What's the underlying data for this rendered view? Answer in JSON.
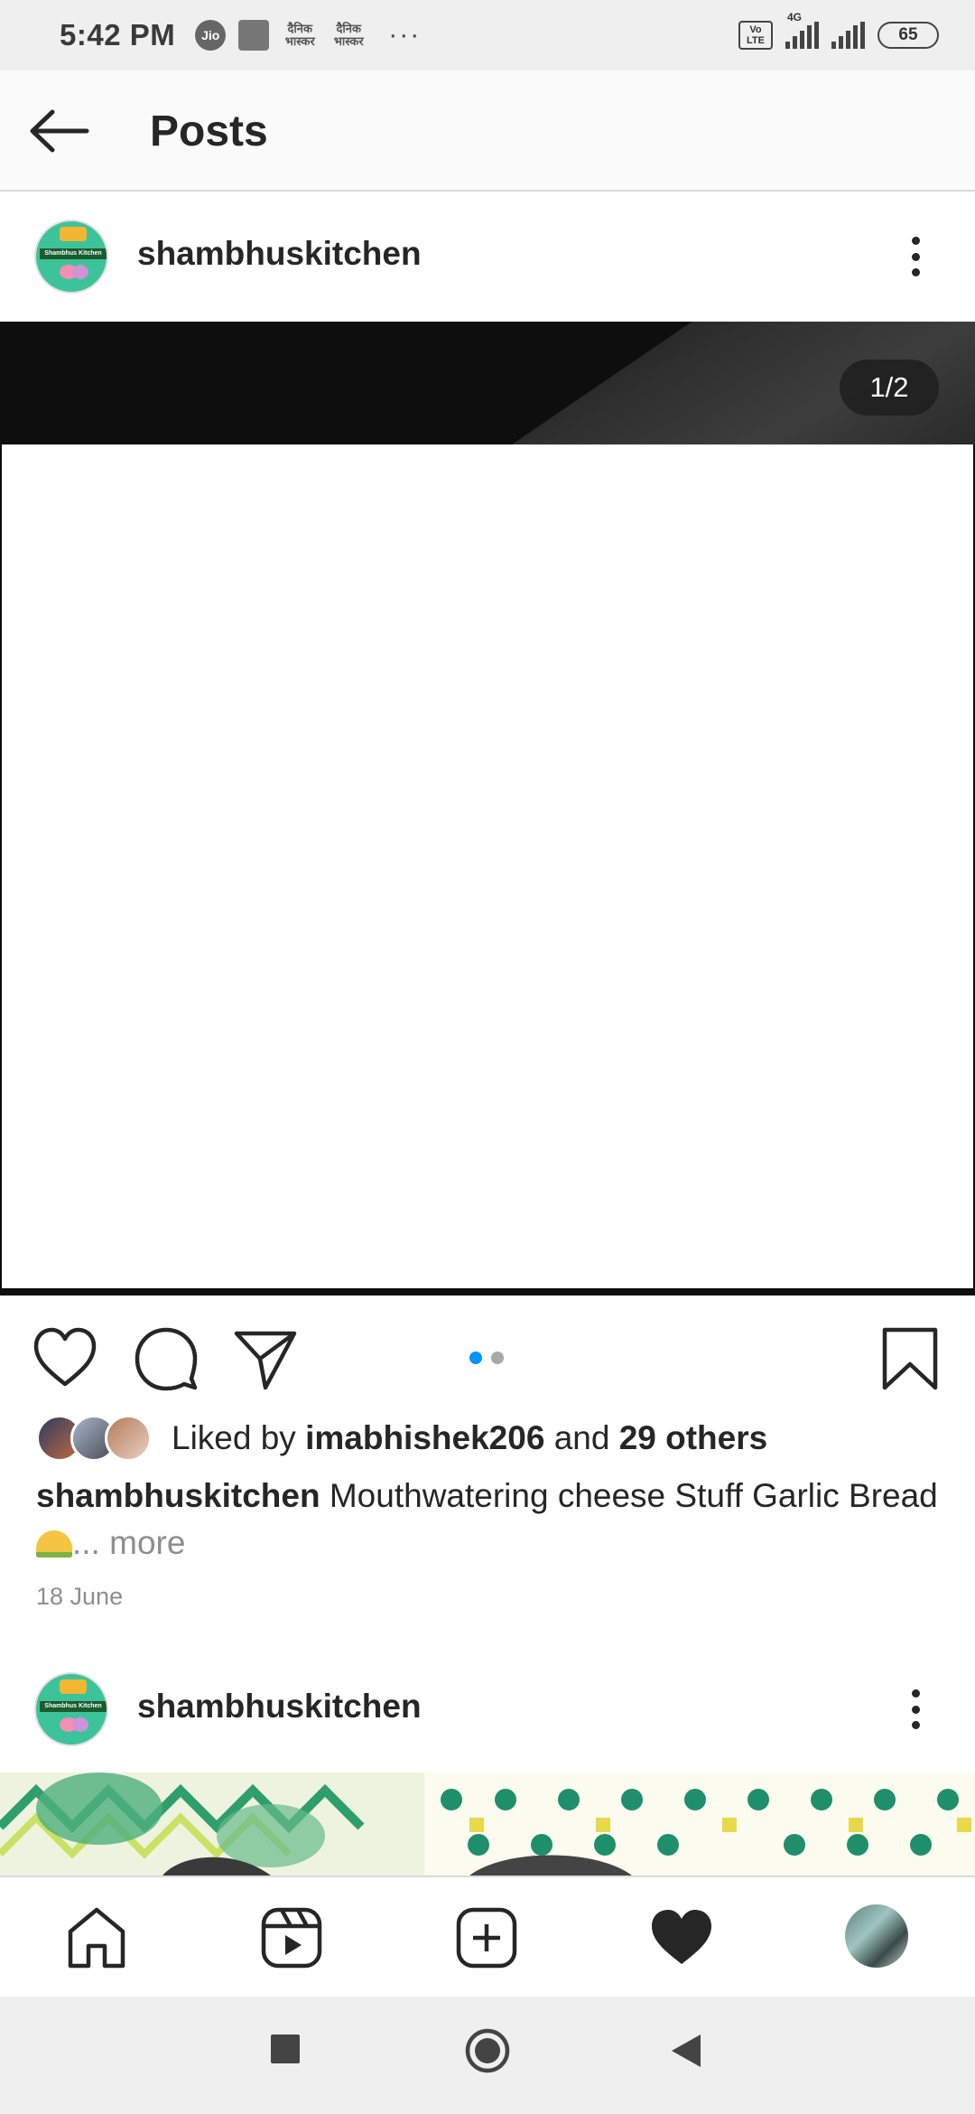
{
  "status_bar": {
    "time": "5:42 PM",
    "carrier_icon": "Jio",
    "app_icons": [
      "jio-icon",
      "sliders-icon",
      "dainik-bhaskar-icon",
      "dainik-bhaskar-icon"
    ],
    "hindi_label_1": "दैनिक भास्कर",
    "hindi_label_2": "दैनिक भास्कर",
    "overflow": "···",
    "volte_label": "Vo LTE",
    "network": "4G",
    "battery": "65"
  },
  "header": {
    "title": "Posts",
    "back_icon": "arrow-left-icon"
  },
  "posts": [
    {
      "username": "shambhuskitchen",
      "avatar_text": "Shambhus Kitchen",
      "media_counter": "1/2",
      "carousel": {
        "count": 2,
        "active_index": 0
      },
      "likes": {
        "prefix": "Liked by",
        "user": "imabhishek206",
        "middle": "and",
        "others": "29 others"
      },
      "caption": {
        "username": "shambhuskitchen",
        "text": "Mouthwatering cheese Stuff Garlic Bread",
        "more": "... more"
      },
      "date": "18 June"
    },
    {
      "username": "shambhuskitchen",
      "avatar_text": "Shambhus Kitchen"
    }
  ],
  "colors": {
    "accent_dot": "#0095f6",
    "inactive_dot": "#a8a8a8",
    "text": "#262626",
    "secondary_text": "#8e8e8e"
  },
  "bottom_nav": [
    "home-icon",
    "reels-icon",
    "new-post-icon",
    "activity-heart-icon",
    "profile-avatar"
  ],
  "system_nav": [
    "recents-square-icon",
    "home-circle-icon",
    "back-triangle-icon"
  ]
}
